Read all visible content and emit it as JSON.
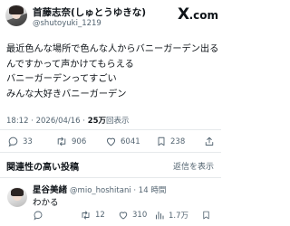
{
  "tweet": {
    "display_name": "首藤志奈(しゅとうゆきな)",
    "handle": "@shutoyuki_1219",
    "lines": [
      "最近色んな場所で色んな人からバニーガーデン出る",
      "んですかって声かけてもらえる",
      "バニーガーデンってすごい",
      "みんな大好きバニーガーデン"
    ],
    "timestamp": "18:12 · 2026/04/16 · ",
    "views_count": "25万",
    "views_label": "回表示",
    "actions": {
      "replies": "33",
      "reposts": "906",
      "likes": "6041",
      "bookmarks": "238"
    }
  },
  "brand": {
    "logo_x": "X",
    "logo_suffix": ".com"
  },
  "related": {
    "title": "関連性の高い投稿",
    "link": "返信を表示"
  },
  "reply": {
    "display_name": "星谷美緒",
    "handle": "@mio_hoshitani",
    "time": " · 14 時間",
    "text": "わかる",
    "actions": {
      "replies": "",
      "reposts": "12",
      "likes": "310",
      "views": "1.7万"
    }
  },
  "colors": {
    "text": "#0f1419",
    "secondary": "#536471",
    "divider": "#e6e9eb",
    "background": "#ffffff"
  }
}
